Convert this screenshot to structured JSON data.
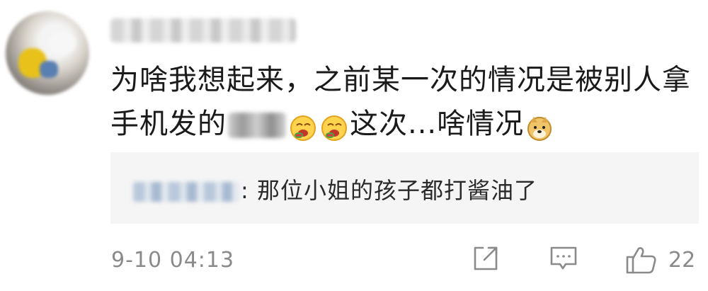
{
  "comment": {
    "author": "",
    "text_part1": "为啥我想起来，之前某一次的情况是被别人拿手机发的",
    "text_part2": "这次...啥情况",
    "timestamp": "9-10 04:13",
    "like_count": "22"
  },
  "reply": {
    "author": "",
    "separator": ":",
    "text": "那位小姐的孩子都打酱油了"
  },
  "icons": {
    "share": "share-icon",
    "comment": "comment-icon",
    "like": "thumbs-up-icon",
    "emoji1": "drooling-face-emoji",
    "emoji2": "drooling-face-emoji",
    "emoji3": "doge-emoji"
  }
}
